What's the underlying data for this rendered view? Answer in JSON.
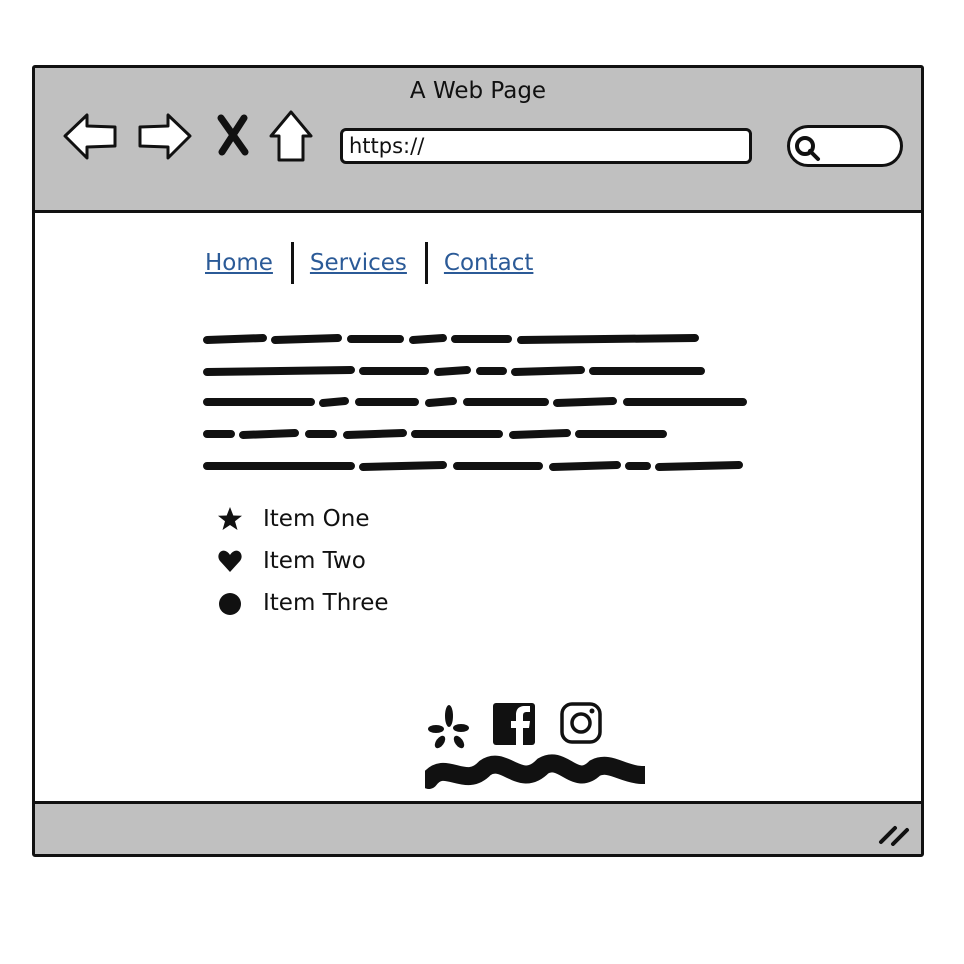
{
  "window": {
    "title": "A Web Page"
  },
  "toolbar": {
    "back_icon": "back-arrow-icon",
    "forward_icon": "forward-arrow-icon",
    "stop_icon": "close-icon",
    "home_icon": "home-icon",
    "url_value": "https://",
    "search_icon": "search-icon"
  },
  "nav": {
    "items": [
      {
        "label": "Home"
      },
      {
        "label": "Services"
      },
      {
        "label": "Contact"
      }
    ]
  },
  "list": {
    "items": [
      {
        "icon": "star-icon",
        "label": "Item One"
      },
      {
        "icon": "heart-icon",
        "label": "Item Two"
      },
      {
        "icon": "circle-icon",
        "label": "Item Three"
      }
    ]
  },
  "social": {
    "icons": [
      "yelp-icon",
      "facebook-icon",
      "instagram-icon"
    ]
  },
  "colors": {
    "chrome": "#c0c0c0",
    "link": "#2b5a97",
    "ink": "#111111"
  }
}
